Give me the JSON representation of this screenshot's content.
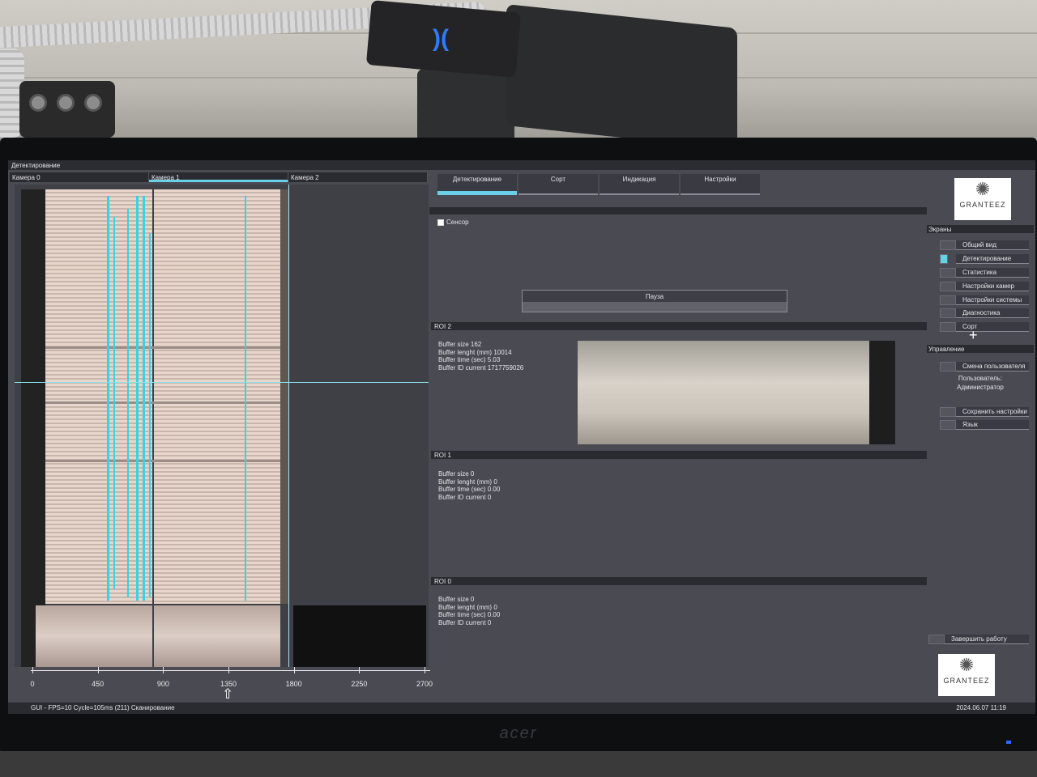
{
  "window": {
    "title": "Детектирование"
  },
  "cameras": {
    "tabs": [
      "Камера 0",
      "Камера 1",
      "Камера 2"
    ],
    "active_tab": 1
  },
  "timeline": {
    "ticks": [
      "0",
      "450",
      "900",
      "1350",
      "1800",
      "2250",
      "2700"
    ],
    "marker_value": 1350
  },
  "tabs": [
    {
      "label": "Детектирование",
      "active": true
    },
    {
      "label": "Сорт",
      "active": false
    },
    {
      "label": "Индикация",
      "active": false
    },
    {
      "label": "Настройки",
      "active": false
    }
  ],
  "sensor": {
    "label": "Сенсор",
    "checked": false
  },
  "pause_button": {
    "label": "Пауза"
  },
  "rois": [
    {
      "title": "ROI 2",
      "lines": [
        "Buffer size 162",
        "Buffer lenght (mm) 10014",
        "Buffer time (sec) 5.03",
        "Buffer ID current 1717759026"
      ]
    },
    {
      "title": "ROI 1",
      "lines": [
        "Buffer size 0",
        "Buffer lenght (mm) 0",
        "Buffer time (sec) 0.00",
        "Buffer ID current 0"
      ]
    },
    {
      "title": "ROI 0",
      "lines": [
        "Buffer size 0",
        "Buffer lenght (mm) 0",
        "Buffer time (sec) 0.00",
        "Buffer ID current 0"
      ]
    }
  ],
  "logo": {
    "brand": "GRANTEEZ"
  },
  "screens": {
    "title": "Экраны",
    "items": [
      "Общий вид",
      "Детектирование",
      "Статистика",
      "Настройки камер",
      "Настройки системы",
      "Диагностика",
      "Сорт"
    ],
    "active_index": 1
  },
  "control": {
    "title": "Управление",
    "change_user": "Смена пользователя",
    "user_label": "Пользователь:",
    "user_name": "Администратор",
    "save_settings": "Сохранить настройки",
    "language": "Язык",
    "finish": "Завершить работу"
  },
  "status": {
    "text": "GUI - FPS=10 Cycle=105ms (211) Сканирование",
    "datetime": "2024.06.07  11:19"
  },
  "monitor": {
    "brand": "acer"
  },
  "colors": {
    "accent": "#6ad0e8",
    "defect": "#2fd6e6",
    "panel": "#4a4a52",
    "header": "#2a2a31"
  }
}
